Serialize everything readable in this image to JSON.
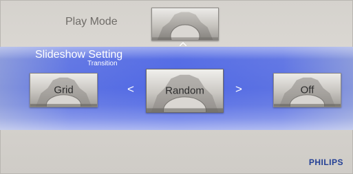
{
  "header": {
    "title": "Play Mode"
  },
  "slideshow": {
    "title": "Slideshow Setting",
    "subtitle": "Transition",
    "options": [
      {
        "label": "Grid",
        "state": "previous"
      },
      {
        "label": "Random",
        "state": "selected"
      },
      {
        "label": "Off",
        "state": "next"
      }
    ]
  },
  "navigation": {
    "prev_glyph": "<",
    "next_glyph": ">",
    "up_icon": "chevron-up-icon"
  },
  "brand": {
    "name": "PHILIPS"
  },
  "colors": {
    "band": "#5068e4",
    "brand": "#233f95"
  }
}
